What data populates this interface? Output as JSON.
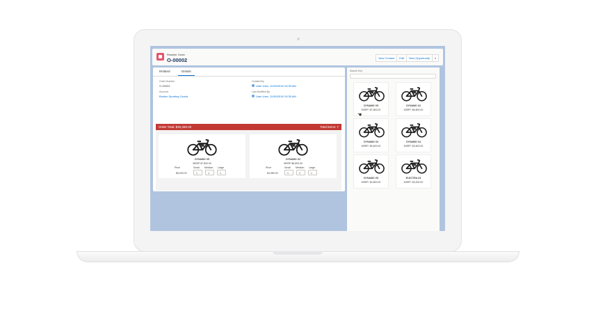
{
  "record": {
    "object_type": "Reseller Order",
    "name": "O-00002"
  },
  "header_buttons": [
    "New Contact",
    "Edit",
    "New Opportunity"
  ],
  "tabs": [
    "Related",
    "Details"
  ],
  "fields": {
    "order_number_label": "Order Number",
    "order_number": "O-00002",
    "created_by_label": "Created By",
    "created_by": "User User, 11/30/2018 10:35 AM",
    "account_label": "Account",
    "account": "Boston Sporting Goods",
    "last_modified_label": "Last Modified By",
    "last_modified": "User User, 11/30/2018 10:35 AM"
  },
  "order_totals": {
    "total": "Order Total: $30,360.00",
    "items": "Total Items: 7"
  },
  "line_items": [
    {
      "name": "DYNAMO X5",
      "msrp": "MSRP $7,800.00",
      "price_label": "Price",
      "price": "$6,000.00",
      "sizes": [
        "Small",
        "Medium",
        "Large"
      ],
      "qty": [
        "1",
        "1",
        "1"
      ]
    },
    {
      "name": "DYNAMO X2",
      "msrp": "MSRP $6,800.00",
      "price_label": "Price",
      "price": "$4,080.00",
      "sizes": [
        "Small",
        "Medium",
        "Large"
      ],
      "qty": [
        "1",
        "2",
        "1"
      ]
    }
  ],
  "search": {
    "label": "Search Key"
  },
  "products": [
    {
      "name": "DYNAMO X5",
      "msrp": "MSRP: $7,800.00"
    },
    {
      "name": "DYNAMO X2",
      "msrp": "MSRP: $6,800.00"
    },
    {
      "name": "DYNAMO X3",
      "msrp": "MSRP: $5,600.00"
    },
    {
      "name": "DYNAMO X4",
      "msrp": "MSRP: $3,500.00"
    },
    {
      "name": "DYNAMO X5",
      "msrp": "MSRP: $4,800.00"
    },
    {
      "name": "ELECTRA X3",
      "msrp": "MSRP: $3,200.00"
    }
  ],
  "colors": {
    "accent": "#0070d2",
    "total_bar": "#c23934",
    "object_icon": "#e3566b",
    "background": "#b0c4df"
  }
}
